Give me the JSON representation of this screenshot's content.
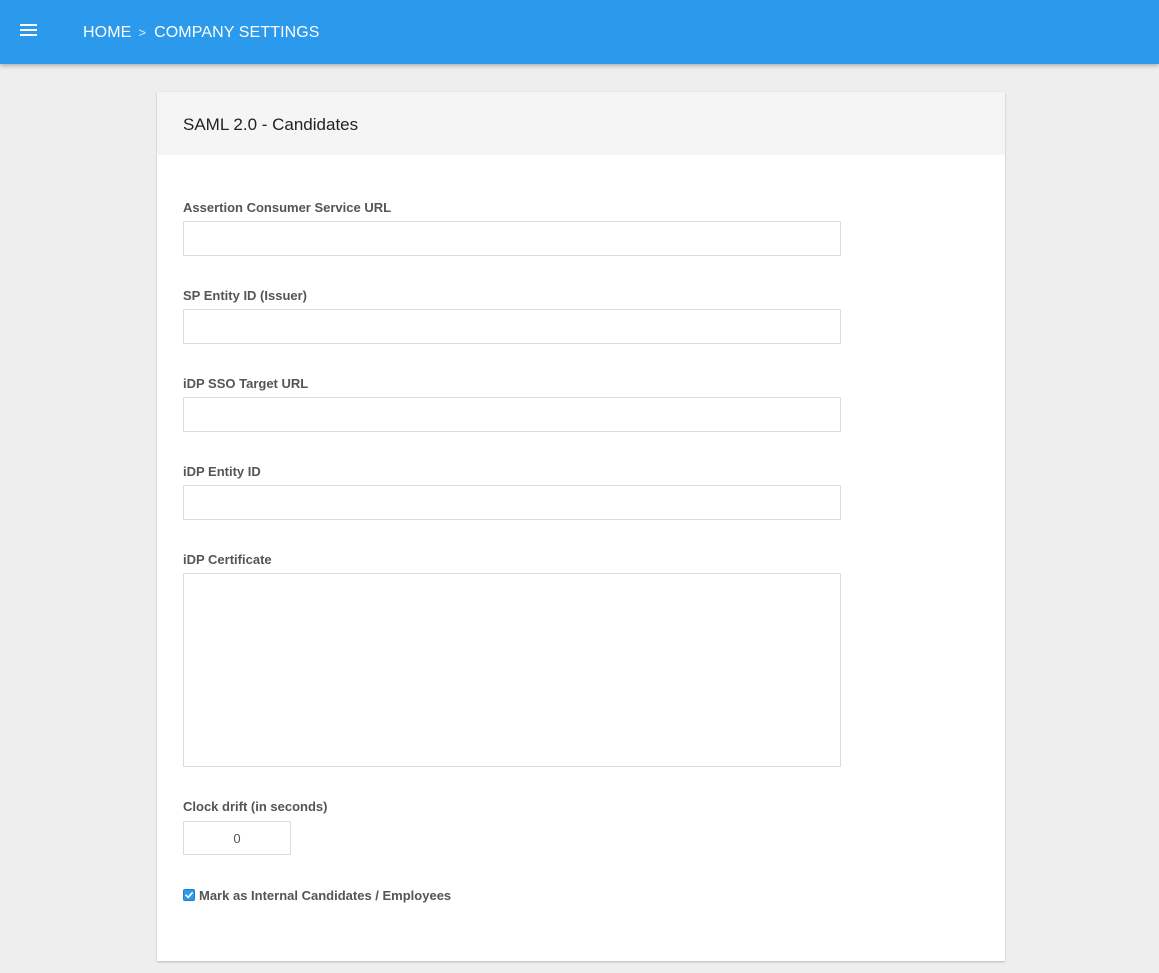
{
  "header": {
    "breadcrumb": [
      "HOME",
      "COMPANY SETTINGS"
    ],
    "separator": ">",
    "menu_icon": "hamburger-menu-icon",
    "background_color": "#2b99ec"
  },
  "card": {
    "title": "SAML 2.0 - Candidates",
    "fields": {
      "acs_url": {
        "label": "Assertion Consumer Service URL",
        "value": ""
      },
      "sp_entity_id": {
        "label": "SP Entity ID (Issuer)",
        "value": ""
      },
      "idp_sso_url": {
        "label": "iDP SSO Target URL",
        "value": ""
      },
      "idp_entity_id": {
        "label": "iDP Entity ID",
        "value": ""
      },
      "idp_certificate": {
        "label": "iDP Certificate",
        "value": ""
      },
      "clock_drift": {
        "label": "Clock drift (in seconds)",
        "value": "0"
      }
    },
    "internal_checkbox": {
      "label": "Mark as Internal Candidates / Employees",
      "checked": true,
      "icon": "checkmark-icon"
    }
  }
}
